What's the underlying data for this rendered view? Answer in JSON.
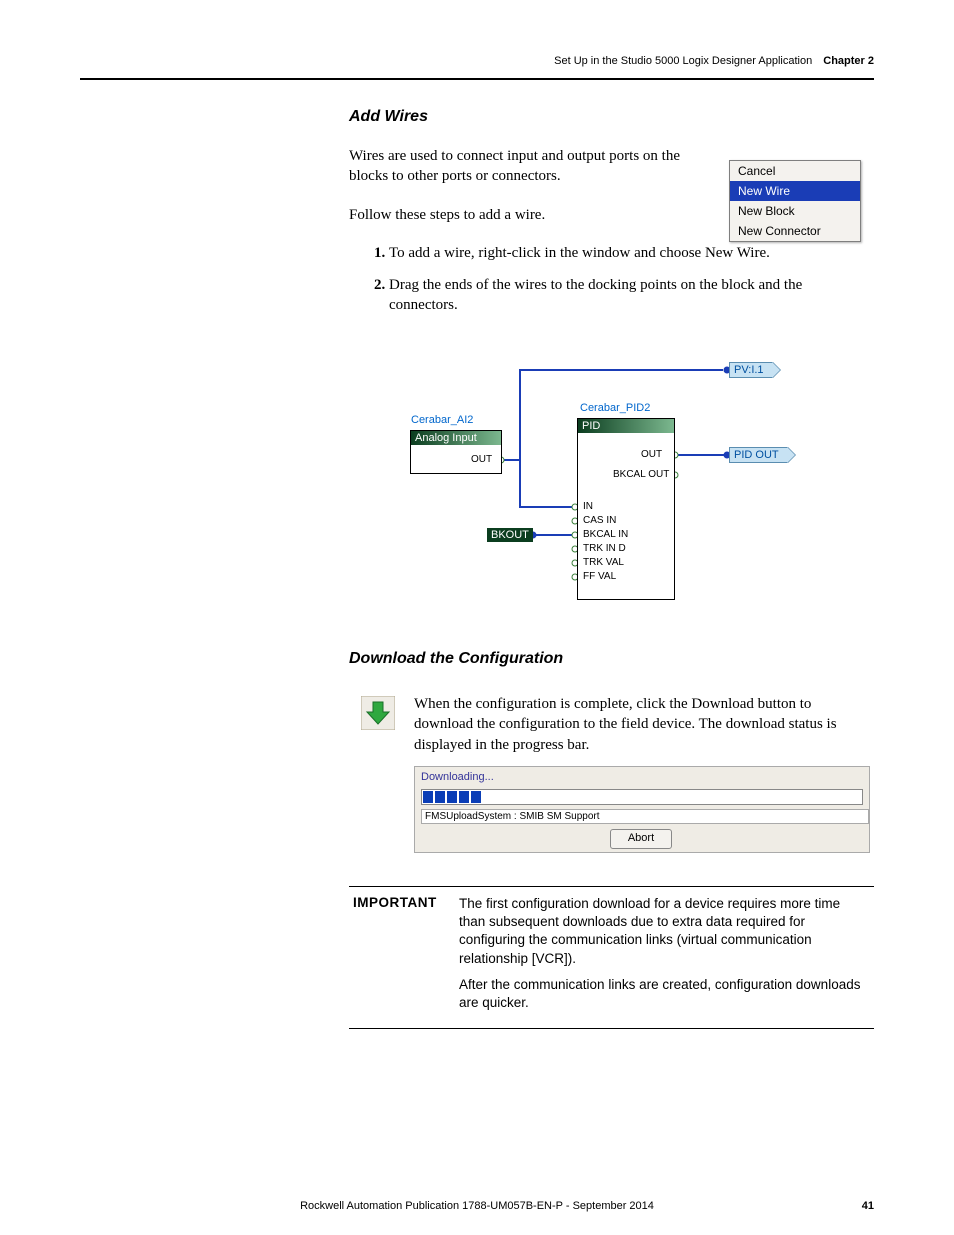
{
  "header": {
    "running_title": "Set Up in the Studio 5000 Logix Designer Application",
    "chapter_label": "Chapter 2"
  },
  "section_add_wires": {
    "title": "Add Wires",
    "intro": "Wires are used to connect input and output ports on the blocks to other ports or connectors.",
    "instruction": "Follow these steps to add a wire.",
    "steps": [
      "To add a wire, right-click in the window and choose New Wire.",
      "Drag the ends of the wires to the docking points on the block and the connectors."
    ]
  },
  "context_menu": {
    "items": [
      "Cancel",
      "New Wire",
      "New Block",
      "New Connector"
    ],
    "selected_index": 1
  },
  "diagram": {
    "block1": {
      "title": "Cerabar_AI2",
      "header": "Analog Input",
      "ports_out": [
        "OUT"
      ]
    },
    "block2": {
      "title": "Cerabar_PID2",
      "header": "PID",
      "ports_out": [
        "OUT",
        "BKCAL OUT"
      ],
      "ports_in": [
        "IN",
        "CAS IN",
        "BKCAL IN",
        "TRK IN D",
        "TRK VAL",
        "FF VAL"
      ]
    },
    "tags": {
      "bkout": "BKOUT"
    },
    "refs": {
      "pv": "PV:I.1",
      "pidout": "PID OUT"
    }
  },
  "section_download": {
    "title": "Download the Configuration",
    "body": "When the configuration is complete, click the Download button to download the configuration to the field device. The download status is displayed in the progress bar."
  },
  "download_figure": {
    "title": "Downloading...",
    "status": "FMSUploadSystem : SMIB SM Support",
    "button": "Abort"
  },
  "important": {
    "label": "IMPORTANT",
    "para1": "The first configuration download for a device requires more time than subsequent downloads due to extra data required for configuring the communication links (virtual communication relationship [VCR]).",
    "para2": "After the communication links are created, configuration downloads are quicker."
  },
  "footer": {
    "publication": "Rockwell Automation Publication 1788-UM057B-EN-P - September 2014",
    "page_number": "41"
  }
}
